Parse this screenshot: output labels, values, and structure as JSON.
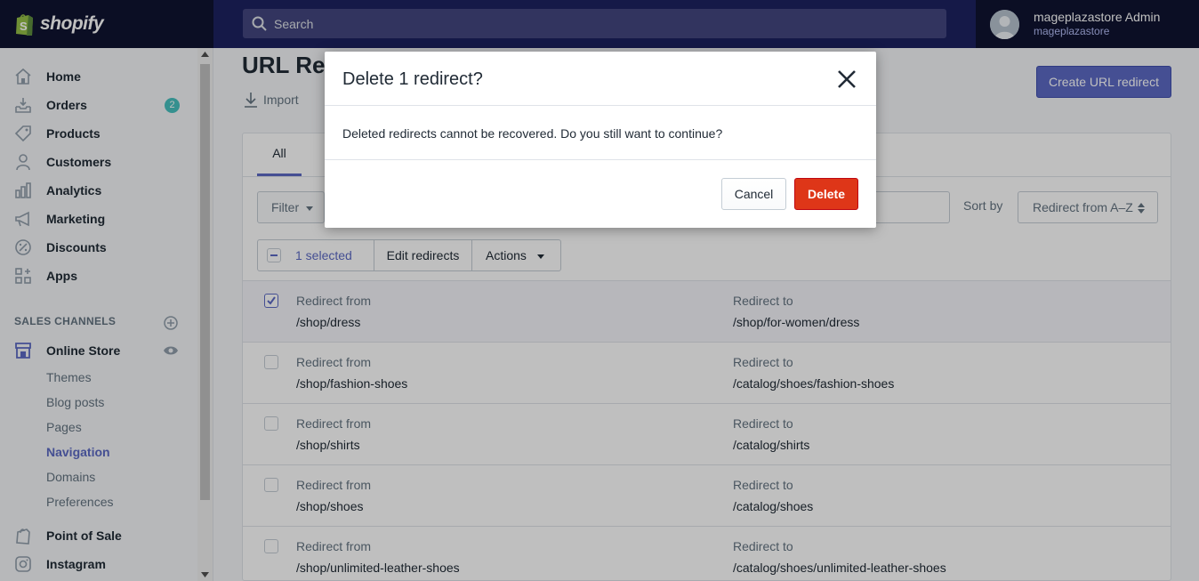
{
  "brand": {
    "name": "shopify"
  },
  "search": {
    "placeholder": "Search"
  },
  "user": {
    "name": "mageplazastore Admin",
    "store": "mageplazastore"
  },
  "sidebar": {
    "items": [
      {
        "label": "Home",
        "icon": "home-icon"
      },
      {
        "label": "Orders",
        "icon": "orders-icon",
        "badge": "2"
      },
      {
        "label": "Products",
        "icon": "tag-icon"
      },
      {
        "label": "Customers",
        "icon": "person-icon"
      },
      {
        "label": "Analytics",
        "icon": "bar-chart-icon"
      },
      {
        "label": "Marketing",
        "icon": "megaphone-icon"
      },
      {
        "label": "Discounts",
        "icon": "discount-icon"
      },
      {
        "label": "Apps",
        "icon": "apps-icon"
      }
    ],
    "sales_channels_title": "SALES CHANNELS",
    "online_store": "Online Store",
    "sub_items": [
      "Themes",
      "Blog posts",
      "Pages",
      "Navigation",
      "Domains",
      "Preferences"
    ],
    "point_of_sale": "Point of Sale",
    "instagram": "Instagram"
  },
  "page": {
    "title": "URL Redirects",
    "import_label": "Import",
    "create_button": "Create URL redirect"
  },
  "list": {
    "tab_all": "All",
    "filter_label": "Filter",
    "sort_label": "Sort by",
    "sort_value": "Redirect from A–Z",
    "bulk": {
      "selected": "1 selected",
      "edit": "Edit redirects",
      "actions": "Actions"
    },
    "col_from": "Redirect from",
    "col_to": "Redirect to",
    "rows": [
      {
        "from": "/shop/dress",
        "to": "/shop/for-women/dress",
        "checked": true
      },
      {
        "from": "/shop/fashion-shoes",
        "to": "/catalog/shoes/fashion-shoes",
        "checked": false
      },
      {
        "from": "/shop/shirts",
        "to": "/catalog/shirts",
        "checked": false
      },
      {
        "from": "/shop/shoes",
        "to": "/catalog/shoes",
        "checked": false
      },
      {
        "from": "/shop/unlimited-leather-shoes",
        "to": "/catalog/shoes/unlimited-leather-shoes",
        "checked": false
      }
    ]
  },
  "modal": {
    "title": "Delete 1 redirect?",
    "message": "Deleted redirects cannot be recovered. Do you still want to continue?",
    "cancel": "Cancel",
    "delete": "Delete"
  },
  "colors": {
    "accent": "#5c6ac4",
    "danger": "#de3618",
    "topbar": "#1c2260",
    "badge": "#47c1bf"
  }
}
